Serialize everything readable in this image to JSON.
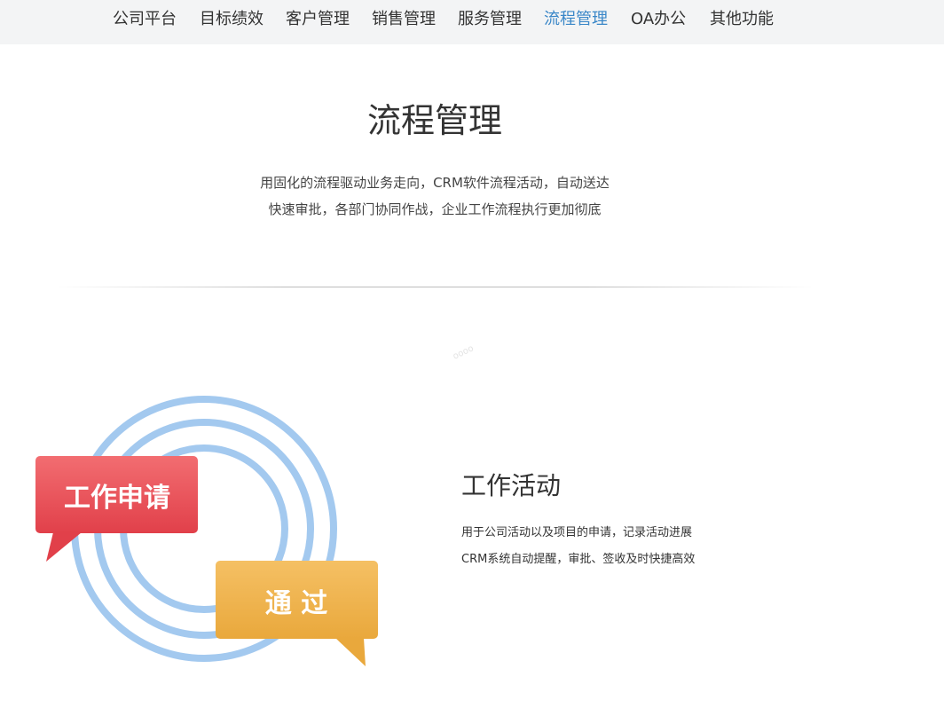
{
  "nav": {
    "items": [
      {
        "label": "公司平台"
      },
      {
        "label": "目标绩效"
      },
      {
        "label": "客户管理"
      },
      {
        "label": "销售管理"
      },
      {
        "label": "服务管理"
      },
      {
        "label": "流程管理",
        "active": true
      },
      {
        "label": "OA办公"
      },
      {
        "label": "其他功能"
      }
    ]
  },
  "hero": {
    "title": "流程管理",
    "lines": [
      "用固化的流程驱动业务走向，CRM软件流程活动，自动送达",
      "快速审批，各部门协同作战，企业工作流程执行更加彻底"
    ]
  },
  "watermark": "oooo",
  "illustration": {
    "bubble_red_text": "工作申请",
    "bubble_orange_text": "通 过"
  },
  "feature": {
    "title": "工作活动",
    "lines": [
      "用于公司活动以及项目的申请，记录活动进展",
      "CRM系统自动提醒，审批、签收及时快捷高效"
    ]
  },
  "colors": {
    "active_nav": "#3a87c8",
    "ring_blue": "#a3c9ef",
    "bubble_red": "#e4464d",
    "bubble_orange": "#eeac44"
  }
}
